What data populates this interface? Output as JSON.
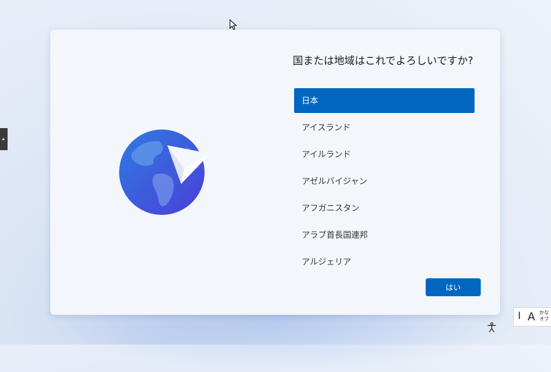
{
  "setup": {
    "question": "国または地域はこれでよろしいですか?",
    "regions": [
      "日本",
      "アイスランド",
      "アイルランド",
      "アゼルバイジャン",
      "アフガニスタン",
      "アラブ首長国連邦",
      "アルジェリア"
    ],
    "selected_region": "日本",
    "yes_label": "はい"
  },
  "ime": {
    "mode_i": "I",
    "mode_a": "A",
    "kana_label": "かな",
    "off_label": "オフ"
  },
  "colors": {
    "accent": "#0067c0",
    "card": "#f3f6fa"
  },
  "icons": {
    "globe": "globe-icon",
    "paper_plane": "paper-plane-icon",
    "accessibility": "accessibility-icon",
    "cursor": "mouse-cursor-icon"
  }
}
